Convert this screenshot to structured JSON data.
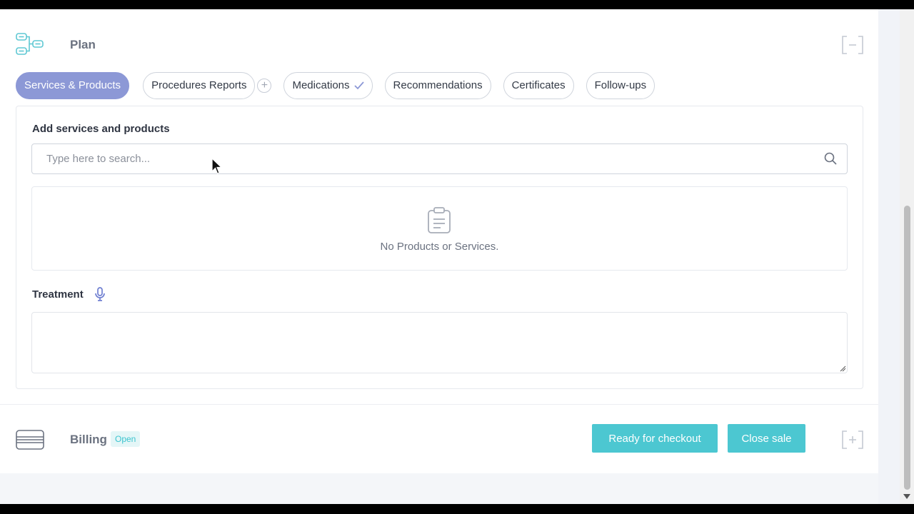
{
  "plan": {
    "title": "Plan",
    "tabs": [
      {
        "label": "Services & Products",
        "active": true
      },
      {
        "label": "Procedures Reports",
        "active": false
      },
      {
        "label": "Medications",
        "active": false,
        "checked": true
      },
      {
        "label": "Recommendations",
        "active": false
      },
      {
        "label": "Certificates",
        "active": false
      },
      {
        "label": "Follow-ups",
        "active": false
      }
    ],
    "add_tab_symbol": "+"
  },
  "services": {
    "section_label": "Add services and products",
    "search_placeholder": "Type here to search...",
    "search_value": "",
    "empty_text": "No Products or Services."
  },
  "treatment": {
    "label": "Treatment",
    "value": ""
  },
  "billing": {
    "title": "Billing",
    "status_badge": "Open",
    "ready_button": "Ready for checkout",
    "close_button": "Close sale"
  },
  "colors": {
    "accent": "#8c98d6",
    "teal": "#4cc7d1",
    "badge_bg": "#e4f6f7"
  },
  "icons": {
    "plan": "flowchart-icon",
    "billing": "credit-card-icon",
    "search": "search-icon",
    "empty": "clipboard-icon",
    "treatment": "microphone-icon"
  }
}
